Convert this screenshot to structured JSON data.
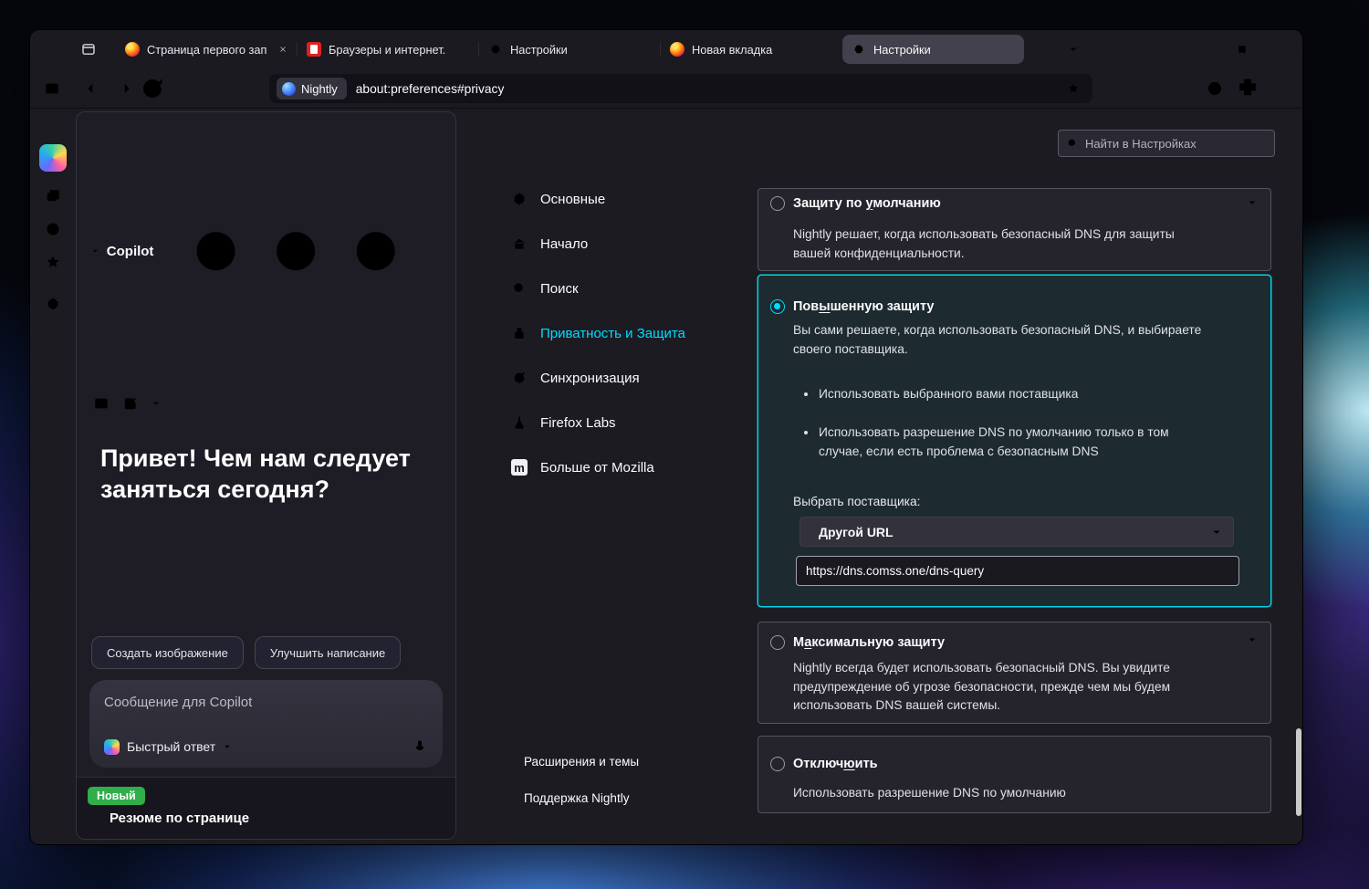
{
  "accent": "#00ddff",
  "tabbar": {
    "tabs": [
      {
        "title": "Страница первого запуска"
      },
      {
        "title": "Браузеры и интернет. Ска"
      },
      {
        "title": "Настройки"
      },
      {
        "title": "Новая вкладка"
      },
      {
        "title": "Настройки"
      }
    ]
  },
  "navbar": {
    "chip": "Nightly",
    "url": "about:preferences#privacy"
  },
  "copilot": {
    "title": "Copilot",
    "greeting": "Привет! Чем нам следует заняться сегодня?",
    "chips": [
      "Создать изображение",
      "Улучшить написание"
    ],
    "composer_placeholder": "Сообщение для Copilot",
    "mode": "Быстрый ответ",
    "new_badge": "Новый",
    "page_summary": "Резюме по странице"
  },
  "settings": {
    "search_placeholder": "Найти в Настройках",
    "mozilla_glyph": "m",
    "nav": [
      {
        "label": "Основные"
      },
      {
        "label": "Начало"
      },
      {
        "label": "Поиск"
      },
      {
        "label": "Приватность и Защита"
      },
      {
        "label": "Синхронизация"
      },
      {
        "label": "Firefox Labs"
      },
      {
        "label": "Больше от Mozilla"
      }
    ],
    "nav_footer": [
      {
        "label": "Расширения и темы"
      },
      {
        "label": "Поддержка Nightly"
      }
    ]
  },
  "dns": {
    "options": [
      {
        "label_pre": "Защиту по ",
        "label_key": "у",
        "label_post": "молчанию",
        "description": "Nightly решает, когда использовать безопасный DNS для защиты вашей конфиденциальности."
      },
      {
        "label_pre": "Пов",
        "label_key": "ы",
        "label_post": "шенную защиту",
        "description": "Вы сами решаете, когда использовать безопасный DNS, и выбираете своего поставщика.",
        "bullets": [
          "Использовать выбранного вами поставщика",
          "Использовать разрешение DNS по умолчанию только в том случае, если есть проблема с безопасным DNS"
        ],
        "provider_label": "Выбрать поставщика:",
        "provider_value": "Другой URL",
        "custom_url": "https://dns.comss.one/dns-query"
      },
      {
        "label_pre": "М",
        "label_key": "а",
        "label_post": "ксимальную защиту",
        "description": "Nightly всегда будет использовать безопасный DNS. Вы увидите предупреждение об угрозе безопасности, прежде чем мы будем использовать DNS вашей системы."
      },
      {
        "label_pre": "Отключ",
        "label_key": "ю",
        "label_post": "ить",
        "description": "Использовать разрешение DNS по умолчанию"
      }
    ]
  }
}
